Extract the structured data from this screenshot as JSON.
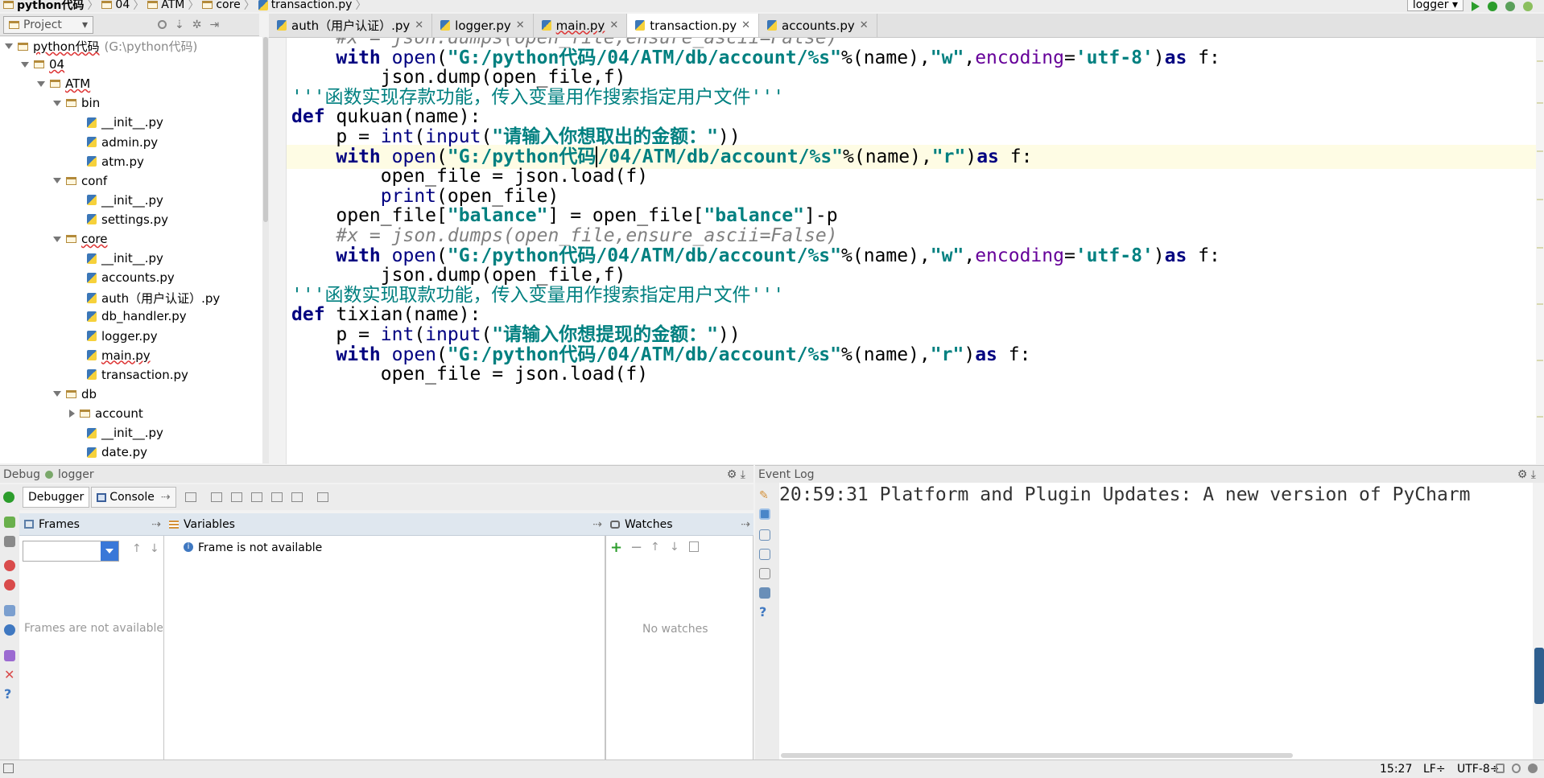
{
  "breadcrumb": [
    "python代码",
    "04",
    "ATM",
    "core",
    "transaction.py"
  ],
  "run_config": {
    "selected": "logger"
  },
  "project_panel": {
    "title": "Project",
    "tree": [
      {
        "label": "python代码",
        "hint": "(G:\\python代码)",
        "type": "folder",
        "level": 0,
        "expanded": true
      },
      {
        "label": "04",
        "type": "folder",
        "level": 1,
        "expanded": true
      },
      {
        "label": "ATM",
        "type": "folder",
        "level": 2,
        "expanded": true
      },
      {
        "label": "bin",
        "type": "folder",
        "level": 3,
        "expanded": true
      },
      {
        "label": "__init__.py",
        "type": "file",
        "level": 4
      },
      {
        "label": "admin.py",
        "type": "file",
        "level": 4
      },
      {
        "label": "atm.py",
        "type": "file",
        "level": 4
      },
      {
        "label": "conf",
        "type": "folder",
        "level": 3,
        "expanded": true
      },
      {
        "label": "__init__.py",
        "type": "file",
        "level": 4
      },
      {
        "label": "settings.py",
        "type": "file",
        "level": 4
      },
      {
        "label": "core",
        "type": "folder",
        "level": 3,
        "expanded": true
      },
      {
        "label": "__init__.py",
        "type": "file",
        "level": 4
      },
      {
        "label": "accounts.py",
        "type": "file",
        "level": 4
      },
      {
        "label": "auth（用户认证）.py",
        "type": "file",
        "level": 4
      },
      {
        "label": "db_handler.py",
        "type": "file",
        "level": 4
      },
      {
        "label": "logger.py",
        "type": "file",
        "level": 4
      },
      {
        "label": "main.py",
        "type": "file",
        "level": 4
      },
      {
        "label": "transaction.py",
        "type": "file",
        "level": 4
      },
      {
        "label": "db",
        "type": "folder",
        "level": 3,
        "expanded": true
      },
      {
        "label": "account",
        "type": "folder",
        "level": 4,
        "expanded": false
      },
      {
        "label": "__init__.py",
        "type": "file",
        "level": 4
      },
      {
        "label": "date.py",
        "type": "file",
        "level": 4
      }
    ]
  },
  "tabs": [
    {
      "label": "auth（用户认证）.py",
      "active": false
    },
    {
      "label": "logger.py",
      "active": false
    },
    {
      "label": "main.py",
      "active": false
    },
    {
      "label": "transaction.py",
      "active": true
    },
    {
      "label": "accounts.py",
      "active": false
    }
  ],
  "editor": {
    "caret_line": 5,
    "lines": [
      [
        [
          "cm",
          "    #x = json.dumps(open_file,ensure_ascii=False)"
        ]
      ],
      [
        [
          "",
          "    "
        ],
        [
          "kw",
          "with "
        ],
        [
          "bi",
          "open"
        ],
        [
          "",
          "("
        ],
        [
          "st",
          "\"G:/python代码/04/ATM/db/account/%s\""
        ],
        [
          "",
          "%(name),"
        ],
        [
          "st",
          "\"w\""
        ],
        [
          "",
          ","
        ],
        [
          "ar",
          "encoding"
        ],
        [
          "",
          "="
        ],
        [
          "st",
          "'utf-8'"
        ],
        [
          "",
          ")"
        ],
        [
          "kw",
          "as "
        ],
        [
          "",
          "f:"
        ]
      ],
      [
        [
          "",
          "        json.dump(open_file,f)"
        ]
      ],
      [
        [
          "doc",
          "'''函数实现存款功能，传入变量用作搜索指定用户文件'''"
        ]
      ],
      [
        [
          "kw",
          "def "
        ],
        [
          "",
          "qukuan(name):"
        ]
      ],
      [
        [
          "",
          "    p = "
        ],
        [
          "bi",
          "int"
        ],
        [
          "",
          "("
        ],
        [
          "bi",
          "input"
        ],
        [
          "",
          "("
        ],
        [
          "st",
          "\"请输入你想取出的金额：\""
        ],
        [
          "",
          "))"
        ]
      ],
      [
        [
          "",
          "    "
        ],
        [
          "kw",
          "with "
        ],
        [
          "bi",
          "open"
        ],
        [
          "",
          "("
        ],
        [
          "st",
          "\"G:/python代码"
        ],
        [
          "caret",
          ""
        ],
        [
          "st",
          "/04/ATM/db/account/%s\""
        ],
        [
          "",
          "%(name),"
        ],
        [
          "st",
          "\"r\""
        ],
        [
          "",
          ")"
        ],
        [
          "kw",
          "as "
        ],
        [
          "",
          "f:"
        ]
      ],
      [
        [
          "",
          "        open_file = json.load(f)"
        ]
      ],
      [
        [
          "",
          "        "
        ],
        [
          "bi",
          "print"
        ],
        [
          "",
          "(open_file)"
        ]
      ],
      [
        [
          "",
          "    open_file["
        ],
        [
          "st",
          "\"balance\""
        ],
        [
          "",
          "] = open_file["
        ],
        [
          "st",
          "\"balance\""
        ],
        [
          "",
          "]-p"
        ]
      ],
      [
        [
          "cm",
          "    #x = json.dumps(open_file,ensure_ascii=False)"
        ]
      ],
      [
        [
          "",
          "    "
        ],
        [
          "kw",
          "with "
        ],
        [
          "bi",
          "open"
        ],
        [
          "",
          "("
        ],
        [
          "st",
          "\"G:/python代码/04/ATM/db/account/%s\""
        ],
        [
          "",
          "%(name),"
        ],
        [
          "st",
          "\"w\""
        ],
        [
          "",
          ","
        ],
        [
          "ar",
          "encoding"
        ],
        [
          "",
          "="
        ],
        [
          "st",
          "'utf-8'"
        ],
        [
          "",
          ")"
        ],
        [
          "kw",
          "as "
        ],
        [
          "",
          "f:"
        ]
      ],
      [
        [
          "",
          "        json.dump(open_file,f)"
        ]
      ],
      [
        [
          "doc",
          "'''函数实现取款功能，传入变量用作搜索指定用户文件'''"
        ]
      ],
      [
        [
          "kw",
          "def "
        ],
        [
          "",
          "tixian(name):"
        ]
      ],
      [
        [
          "",
          "    p = "
        ],
        [
          "bi",
          "int"
        ],
        [
          "",
          "("
        ],
        [
          "bi",
          "input"
        ],
        [
          "",
          "("
        ],
        [
          "st",
          "\"请输入你想提现的金额：\""
        ],
        [
          "",
          "))"
        ]
      ],
      [
        [
          "",
          "    "
        ],
        [
          "kw",
          "with "
        ],
        [
          "bi",
          "open"
        ],
        [
          "",
          "("
        ],
        [
          "st",
          "\"G:/python代码/04/ATM/db/account/%s\""
        ],
        [
          "",
          "%(name),"
        ],
        [
          "st",
          "\"r\""
        ],
        [
          "",
          ")"
        ],
        [
          "kw",
          "as "
        ],
        [
          "",
          "f:"
        ]
      ],
      [
        [
          "",
          "        open_file = json.load(f)"
        ]
      ]
    ]
  },
  "debug": {
    "title_prefix": "Debug",
    "config": "logger",
    "tabs": {
      "debugger": "Debugger",
      "console": "Console"
    },
    "frames": {
      "title": "Frames",
      "empty": "Frames are not available"
    },
    "variables": {
      "title": "Variables",
      "message": "Frame is not available"
    },
    "watches": {
      "title": "Watches",
      "empty": "No watches"
    }
  },
  "event_log": {
    "title": "Event Log",
    "entries": [
      "20:59:31 Platform and Plugin Updates: A new version of PyCharm"
    ]
  },
  "status": {
    "position": "15:27",
    "line_sep": "LF÷",
    "encoding": "UTF-8÷"
  }
}
